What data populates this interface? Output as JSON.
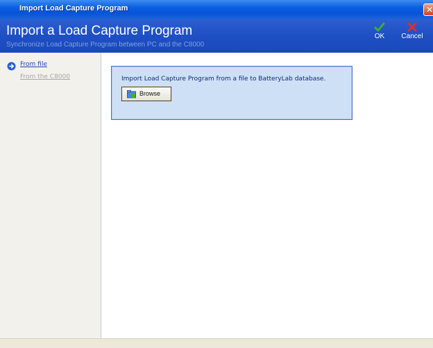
{
  "window": {
    "title": "Import Load Capture Program"
  },
  "header": {
    "title": "Import a Load Capture Program",
    "subtitle": "Synchronize Load Capture Program between PC and the C8000",
    "ok_label": "OK",
    "cancel_label": "Cancel"
  },
  "sidebar": {
    "items": [
      {
        "label": "From file",
        "active": true
      },
      {
        "label": "From the C8000",
        "active": false
      }
    ]
  },
  "panel": {
    "description": "Import Load Capture Program from a file to BatteryLab database.",
    "browse_label": "Browse"
  },
  "icons": {
    "title": "window-icon",
    "close": "close-icon",
    "ok": "green-check-icon",
    "cancel": "red-x-icon",
    "nav": "blue-arrow-icon",
    "browse": "folder-icon"
  },
  "colors": {
    "titlebar": "#0a5fe0",
    "header": "#1e4fc4",
    "panel_bg": "#cde0f6",
    "panel_border": "#4a6ec8",
    "link": "#1547b8"
  }
}
